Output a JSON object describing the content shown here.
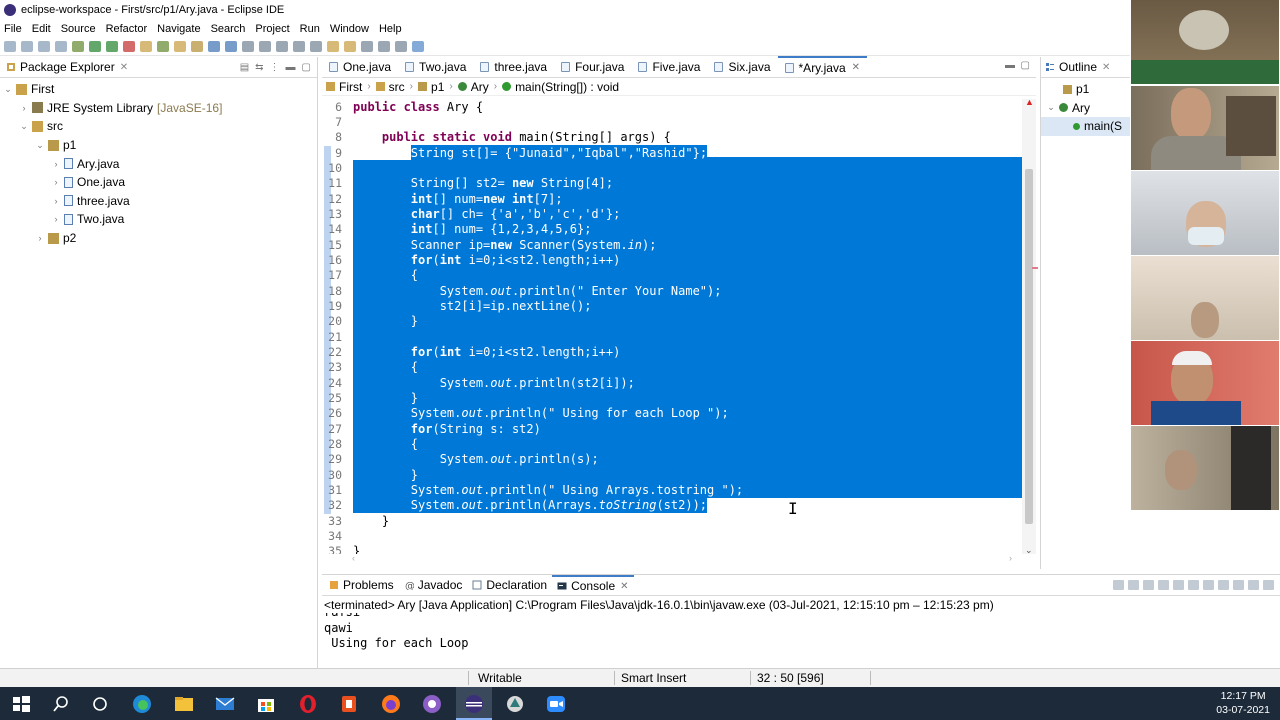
{
  "window": {
    "title": "eclipse-workspace - First/src/p1/Ary.java - Eclipse IDE"
  },
  "menu": [
    "File",
    "Edit",
    "Source",
    "Refactor",
    "Navigate",
    "Search",
    "Project",
    "Run",
    "Window",
    "Help"
  ],
  "package_explorer": {
    "title": "Package Explorer",
    "tree": [
      {
        "label": "First",
        "indent": 0,
        "arrow": "⌄",
        "icon": "project-icon"
      },
      {
        "label": "JRE System Library",
        "suffix": "[JavaSE-16]",
        "indent": 1,
        "arrow": "›",
        "icon": "library-icon"
      },
      {
        "label": "src",
        "indent": 1,
        "arrow": "⌄",
        "icon": "source-folder-icon"
      },
      {
        "label": "p1",
        "indent": 2,
        "arrow": "⌄",
        "icon": "package-icon"
      },
      {
        "label": "Ary.java",
        "indent": 3,
        "arrow": "›",
        "icon": "java-file-icon"
      },
      {
        "label": "One.java",
        "indent": 3,
        "arrow": "›",
        "icon": "java-file-icon"
      },
      {
        "label": "three.java",
        "indent": 3,
        "arrow": "›",
        "icon": "java-file-icon"
      },
      {
        "label": "Two.java",
        "indent": 3,
        "arrow": "›",
        "icon": "java-file-icon"
      },
      {
        "label": "p2",
        "indent": 2,
        "arrow": "›",
        "icon": "package-icon"
      }
    ]
  },
  "editor": {
    "tabs": [
      {
        "label": "One.java",
        "active": false
      },
      {
        "label": "Two.java",
        "active": false
      },
      {
        "label": "three.java",
        "active": false
      },
      {
        "label": "Four.java",
        "active": false
      },
      {
        "label": "Five.java",
        "active": false
      },
      {
        "label": "Six.java",
        "active": false
      },
      {
        "label": "*Ary.java",
        "active": true
      }
    ],
    "breadcrumb": [
      "First",
      "src",
      "p1",
      "Ary",
      "main(String[]) : void"
    ],
    "lines": [
      {
        "n": "6",
        "sel": false,
        "parts": [
          [
            "kw",
            "public class "
          ],
          [
            "",
            "Ary {"
          ]
        ]
      },
      {
        "n": "7",
        "sel": false,
        "parts": []
      },
      {
        "n": "8",
        "sel": false,
        "parts": [
          [
            "",
            "    "
          ],
          [
            "kw",
            "public static void "
          ],
          [
            "",
            "main(String[] args) {"
          ]
        ]
      },
      {
        "n": "9",
        "sel": true,
        "selStart": 8,
        "parts": [
          [
            "",
            "        String st[]= {"
          ],
          [
            "str",
            "\"Junaid\""
          ],
          [
            "",
            ","
          ],
          [
            "str",
            "\"Iqbal\""
          ],
          [
            "",
            ","
          ],
          [
            "str",
            "\"Rashid\""
          ],
          [
            "",
            "};"
          ]
        ]
      },
      {
        "n": "10",
        "sel": true,
        "full": true,
        "parts": []
      },
      {
        "n": "11",
        "sel": true,
        "full": true,
        "parts": [
          [
            "",
            "        String[] st2= "
          ],
          [
            "kw",
            "new "
          ],
          [
            "",
            "String[4];"
          ]
        ]
      },
      {
        "n": "12",
        "sel": true,
        "full": true,
        "parts": [
          [
            "",
            "        "
          ],
          [
            "kw",
            "int"
          ],
          [
            "",
            "[] num="
          ],
          [
            "kw",
            "new int"
          ],
          [
            "",
            "[7];"
          ]
        ]
      },
      {
        "n": "13",
        "sel": true,
        "full": true,
        "parts": [
          [
            "",
            "        "
          ],
          [
            "kw",
            "char"
          ],
          [
            "",
            "[] ch= {'a','b','c','d'};"
          ]
        ]
      },
      {
        "n": "14",
        "sel": true,
        "full": true,
        "parts": [
          [
            "",
            "        "
          ],
          [
            "kw",
            "int"
          ],
          [
            "",
            "[] num= {1,2,3,4,5,6};"
          ]
        ]
      },
      {
        "n": "15",
        "sel": true,
        "full": true,
        "parts": [
          [
            "",
            "        Scanner ip="
          ],
          [
            "kw",
            "new "
          ],
          [
            "",
            "Scanner(System."
          ],
          [
            "it",
            "in"
          ],
          [
            "",
            ");"
          ]
        ]
      },
      {
        "n": "16",
        "sel": true,
        "full": true,
        "parts": [
          [
            "",
            "        "
          ],
          [
            "kw",
            "for"
          ],
          [
            "",
            "("
          ],
          [
            "kw",
            "int "
          ],
          [
            "",
            "i=0;i<st2.length;i++)"
          ]
        ]
      },
      {
        "n": "17",
        "sel": true,
        "full": true,
        "parts": [
          [
            "",
            "        {"
          ]
        ]
      },
      {
        "n": "18",
        "sel": true,
        "full": true,
        "parts": [
          [
            "",
            "            System."
          ],
          [
            "it",
            "out"
          ],
          [
            "",
            ".println(\" Enter Your Name\");"
          ]
        ]
      },
      {
        "n": "19",
        "sel": true,
        "full": true,
        "parts": [
          [
            "",
            "            st2[i]=ip.nextLine();"
          ]
        ]
      },
      {
        "n": "20",
        "sel": true,
        "full": true,
        "parts": [
          [
            "",
            "        }"
          ]
        ]
      },
      {
        "n": "21",
        "sel": true,
        "full": true,
        "parts": []
      },
      {
        "n": "22",
        "sel": true,
        "full": true,
        "parts": [
          [
            "",
            "        "
          ],
          [
            "kw",
            "for"
          ],
          [
            "",
            "("
          ],
          [
            "kw",
            "int "
          ],
          [
            "",
            "i=0;i<st2.length;i++)"
          ]
        ]
      },
      {
        "n": "23",
        "sel": true,
        "full": true,
        "parts": [
          [
            "",
            "        {"
          ]
        ]
      },
      {
        "n": "24",
        "sel": true,
        "full": true,
        "parts": [
          [
            "",
            "            System."
          ],
          [
            "it",
            "out"
          ],
          [
            "",
            ".println(st2[i]);"
          ]
        ]
      },
      {
        "n": "25",
        "sel": true,
        "full": true,
        "parts": [
          [
            "",
            "        }"
          ]
        ]
      },
      {
        "n": "26",
        "sel": true,
        "full": true,
        "parts": [
          [
            "",
            "        System."
          ],
          [
            "it",
            "out"
          ],
          [
            "",
            ".println(\" Using for each Loop \");"
          ]
        ]
      },
      {
        "n": "27",
        "sel": true,
        "full": true,
        "parts": [
          [
            "",
            "        "
          ],
          [
            "kw",
            "for"
          ],
          [
            "",
            "(String s: st2)"
          ]
        ]
      },
      {
        "n": "28",
        "sel": true,
        "full": true,
        "parts": [
          [
            "",
            "        {"
          ]
        ]
      },
      {
        "n": "29",
        "sel": true,
        "full": true,
        "parts": [
          [
            "",
            "            System."
          ],
          [
            "it",
            "out"
          ],
          [
            "",
            ".println(s);"
          ]
        ]
      },
      {
        "n": "30",
        "sel": true,
        "full": true,
        "parts": [
          [
            "",
            "        }"
          ]
        ]
      },
      {
        "n": "31",
        "sel": true,
        "full": true,
        "parts": [
          [
            "",
            "        System."
          ],
          [
            "it",
            "out"
          ],
          [
            "",
            ".println(\" Using Arrays.tostring \");"
          ]
        ]
      },
      {
        "n": "32",
        "sel": true,
        "full": false,
        "parts": [
          [
            "",
            "        System."
          ],
          [
            "it",
            "out"
          ],
          [
            "",
            ".println(Arrays."
          ],
          [
            "it",
            "toString"
          ],
          [
            "",
            "(st2));"
          ]
        ]
      },
      {
        "n": "33",
        "sel": false,
        "parts": [
          [
            "",
            "    }"
          ]
        ]
      },
      {
        "n": "34",
        "sel": false,
        "parts": []
      },
      {
        "n": "35",
        "sel": false,
        "parts": [
          [
            "",
            "}"
          ]
        ]
      }
    ]
  },
  "outline": {
    "title": "Outline",
    "items": [
      "p1",
      "Ary",
      "main(S"
    ]
  },
  "console": {
    "tabs": [
      "Problems",
      "Javadoc",
      "Declaration",
      "Console"
    ],
    "active_tab": "Console",
    "status": "<terminated> Ary [Java Application] C:\\Program Files\\Java\\jdk-16.0.1\\bin\\javaw.exe  (03-Jul-2021, 12:15:10 pm – 12:15:23 pm)",
    "output": [
      "rafsi",
      "qawi",
      " Using for each Loop"
    ]
  },
  "statusbar": {
    "mode": "Writable",
    "insert": "Smart Insert",
    "position": "32 : 50 [596]"
  },
  "taskbar": {
    "time": "12:17 PM",
    "date": "03-07-2021"
  }
}
